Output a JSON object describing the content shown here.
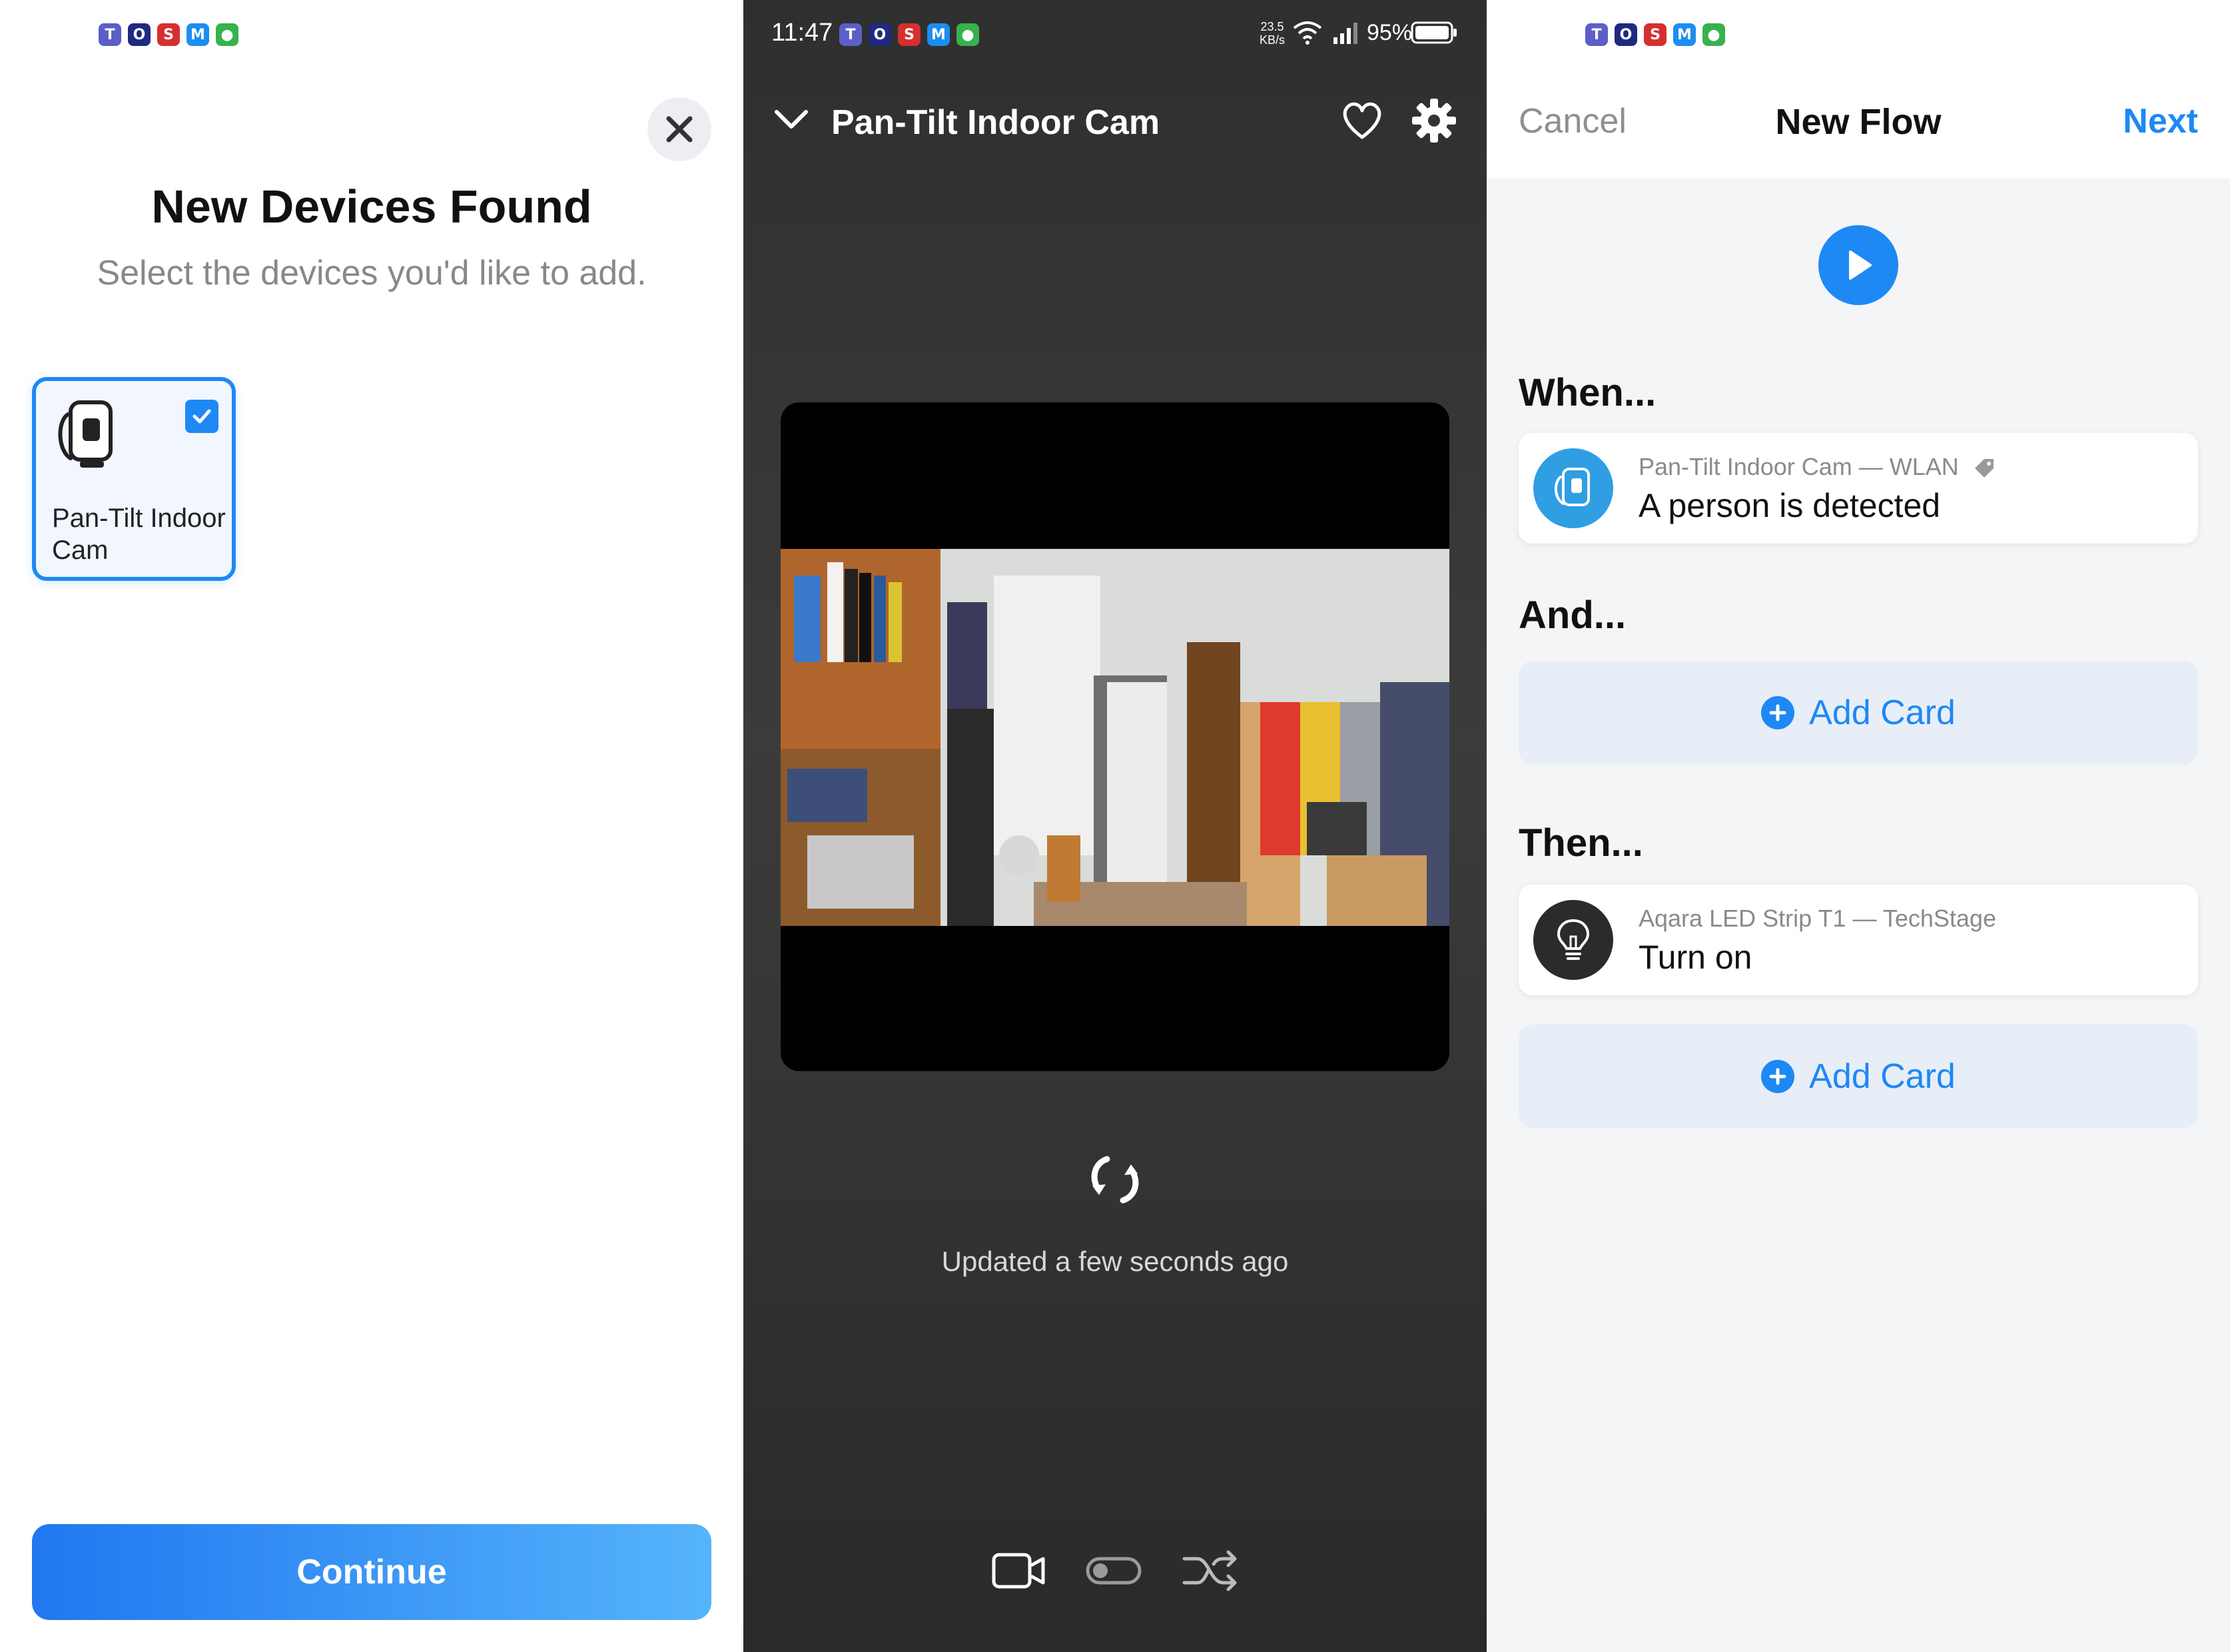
{
  "add_device": {
    "title": "New Devices Found",
    "subtitle": "Select the devices you'd like to add.",
    "device_label": "Pan-Tilt Indoor Cam",
    "continue_label": "Continue"
  },
  "camera": {
    "status_time": "11:47",
    "net_speed": "23.5",
    "net_unit": "KB/s",
    "battery": "95%",
    "title": "Pan-Tilt Indoor Cam",
    "updated_text": "Updated a few seconds ago"
  },
  "flow": {
    "cancel_label": "Cancel",
    "title": "New Flow",
    "next_label": "Next",
    "when_heading": "When...",
    "when_card": {
      "device": "Pan-Tilt Indoor Cam — WLAN",
      "trigger": "A person is detected"
    },
    "and_heading": "And...",
    "add_card_label": "Add Card",
    "then_heading": "Then...",
    "then_card": {
      "device": "Aqara LED Strip T1 — TechStage",
      "action": "Turn on"
    }
  },
  "icons": {
    "status_bar": [
      "teams-icon",
      "skype-icon",
      "s-app-icon",
      "outlook-icon",
      "camera-app-icon"
    ],
    "camera_controls": [
      "record-video-icon",
      "toggle-icon",
      "shuffle-icon"
    ]
  },
  "colors": {
    "accent": "#1e88f5",
    "dark_panel": "#353535",
    "card_bg": "#e8eef7"
  }
}
